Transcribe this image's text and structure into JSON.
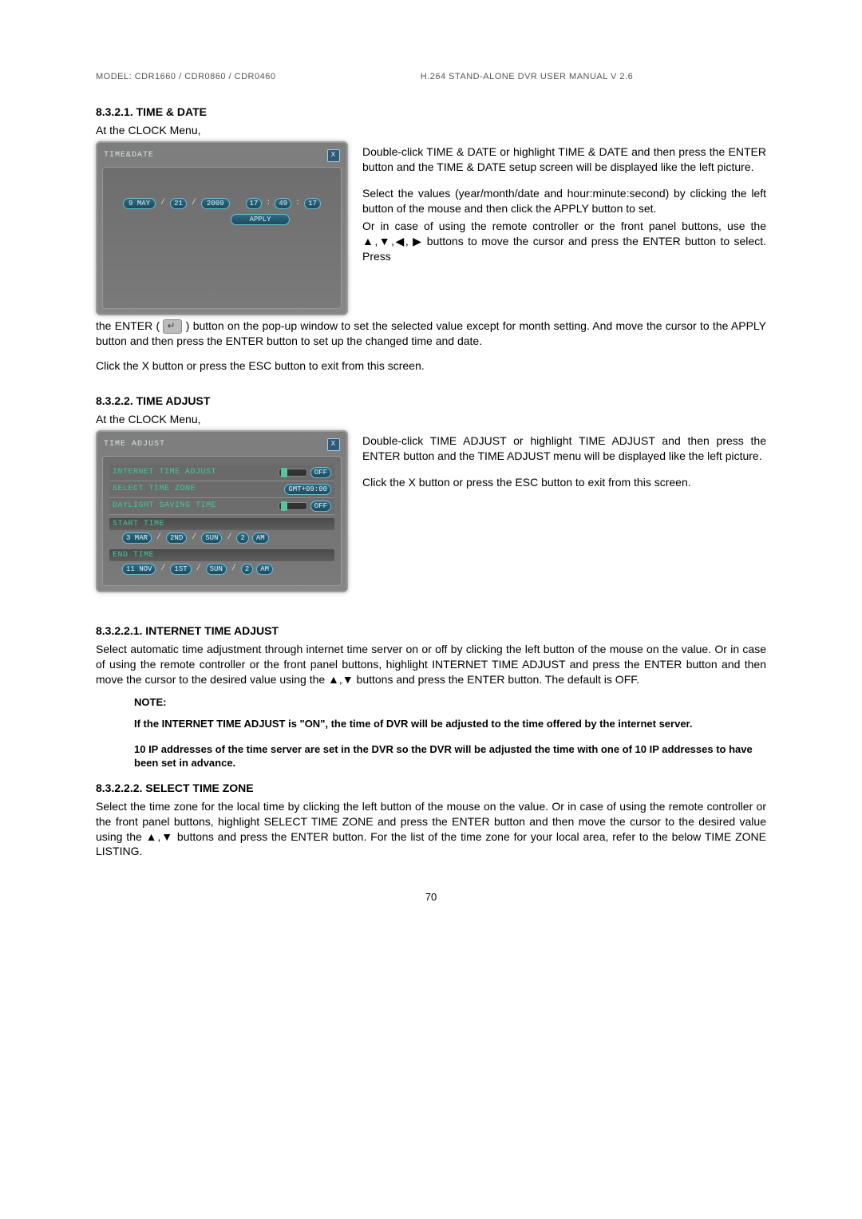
{
  "header": {
    "left": "MODEL: CDR1660 / CDR0860 / CDR0460",
    "right": "H.264 STAND-ALONE DVR USER MANUAL V 2.6"
  },
  "s1": {
    "heading": "8.3.2.1.  TIME & DATE",
    "intro": "At the CLOCK Menu,",
    "p1": "Double-click TIME & DATE or highlight TIME & DATE and then press the ENTER button and the TIME & DATE setup screen will be displayed like the left picture.",
    "p2": "Select the values (year/month/date and hour:minute:second) by clicking the left button of the mouse and then click the APPLY button to set.",
    "p3": "Or in case of using the remote controller or the front panel buttons, use the ▲,▼,◀, ▶  buttons to move the cursor and press the ENTER button to select. Press",
    "p4_a": "the ENTER (",
    "p4_b": ") button on the pop-up window to set the selected value except for month setting.  And move the cursor to the APPLY button and then press the ENTER button to set up the changed time and date.",
    "p5": "Click the X button or press the ESC button to exit from this screen."
  },
  "ui_time_date": {
    "title": "TIME&DATE",
    "day": "9",
    "month": "MAY",
    "dnum": "21",
    "year": "2009",
    "hh": "17",
    "mm": "49",
    "ss": "17",
    "apply": "APPLY"
  },
  "s2": {
    "heading": "8.3.2.2.  TIME ADJUST",
    "intro": "At the CLOCK Menu,",
    "p1": "Double-click TIME ADJUST or highlight TIME ADJUST and then press the ENTER button and the TIME ADJUST menu will be displayed like the left picture.",
    "p2": "Click the X button or press the ESC button to exit from this screen."
  },
  "ui_time_adjust": {
    "title": "TIME ADJUST",
    "row1_label": "INTERNET TIME ADJUST",
    "row1_val": "OFF",
    "row2_label": "SELECT TIME ZONE",
    "row2_val": "GMT+09:00",
    "row3_label": "DAYLIGHT SAVING TIME",
    "row3_val": "OFF",
    "start_head": "START TIME",
    "start_m": "3 MAR",
    "start_w": "2ND",
    "start_d": "SUN",
    "start_h": "2",
    "start_ap": "AM",
    "end_head": "END TIME",
    "end_m": "11 NOV",
    "end_w": "1ST",
    "end_d": "SUN",
    "end_h": "2",
    "end_ap": "AM"
  },
  "s3": {
    "heading": "8.3.2.2.1.  INTERNET TIME ADJUST",
    "p1": "Select automatic time adjustment through internet time server on or off by clicking the left button of the mouse on the value. Or in case of using the remote controller or the front panel buttons, highlight INTERNET TIME ADJUST and press the ENTER button and then move the cursor to the desired value using the ▲,▼  buttons and press  the ENTER  button.   The default is OFF.",
    "note_label": "NOTE:",
    "note1": "If the INTERNET TIME ADJUST is \"ON\", the time of DVR will be adjusted to the time offered by the internet server.",
    "note2": "10 IP addresses of the time server are set in the DVR so the DVR will be adjusted the time with one of 10 IP addresses to have been set in advance."
  },
  "s4": {
    "heading": "8.3.2.2.2.  SELECT TIME ZONE",
    "p1": "Select the time zone for the local time by clicking the left button of the mouse on the value. Or in case of using the remote controller or the front panel buttons, highlight SELECT TIME ZONE and press the ENTER button and then move the cursor to the desired value using the ▲,▼  buttons and press  the ENTER button.  For the list of the time zone for your local area, refer to the below TIME ZONE LISTING."
  },
  "page_number": "70"
}
